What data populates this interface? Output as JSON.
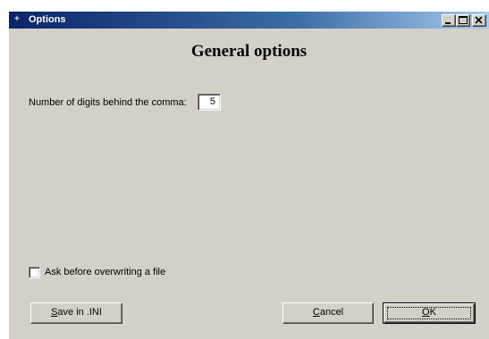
{
  "window": {
    "title": "Options",
    "controls": {
      "minimize_icon": "minimize-icon",
      "maximize_icon": "maximize-icon",
      "close_icon": "close-icon"
    },
    "colors": {
      "titlebar_start": "#0a246a",
      "titlebar_end": "#a6caf0",
      "face": "#d4d0c8"
    }
  },
  "dialog": {
    "heading": "General options",
    "digits": {
      "label": "Number of digits behind the comma:",
      "value": "5"
    },
    "overwrite_check": {
      "label": "Ask before overwriting a file",
      "checked": false
    }
  },
  "buttons": {
    "save_ini": {
      "mnemonic": "S",
      "rest": "ave in .INI"
    },
    "cancel": {
      "mnemonic": "C",
      "rest": "ancel"
    },
    "ok": {
      "mnemonic": "O",
      "rest": "K",
      "default": true
    }
  }
}
